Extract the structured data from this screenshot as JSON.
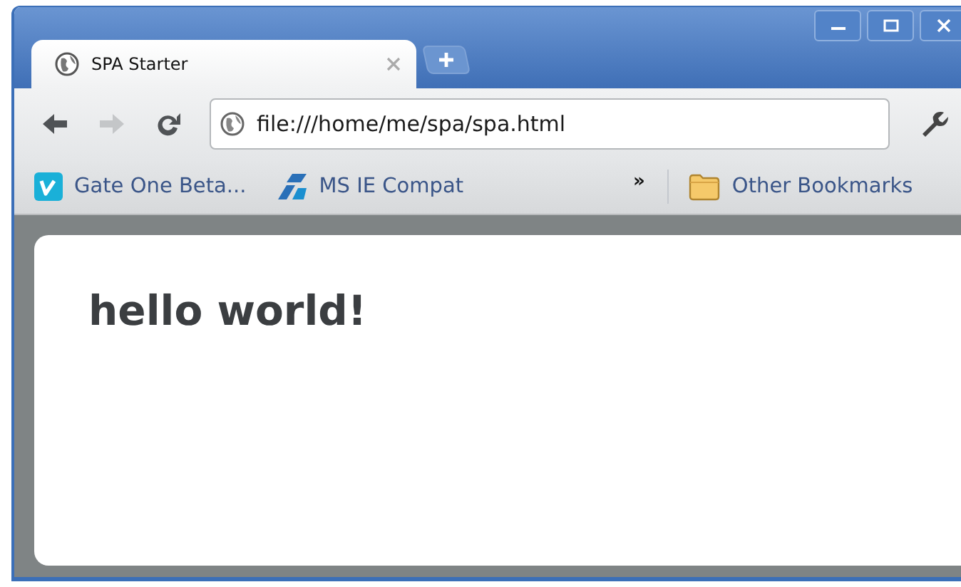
{
  "tabs": [
    {
      "title": "SPA Starter",
      "selected": true
    }
  ],
  "navigation": [
    {
      "kind": "back",
      "disabled": false
    },
    {
      "kind": "forward",
      "disabled": true
    },
    {
      "kind": "reload",
      "disabled": false
    }
  ],
  "address_bar": {
    "value": "file:///home/me/spa/spa.html"
  },
  "bookmarks": [
    {
      "label": "Gate One Beta...",
      "kind": "letter"
    },
    {
      "label": "MS IE Compat",
      "kind": "shards"
    }
  ],
  "bookmarks_overflow": "»",
  "other_bookmarks": {
    "label": "Other Bookmarks"
  },
  "page": {
    "heading": "hello world!"
  }
}
